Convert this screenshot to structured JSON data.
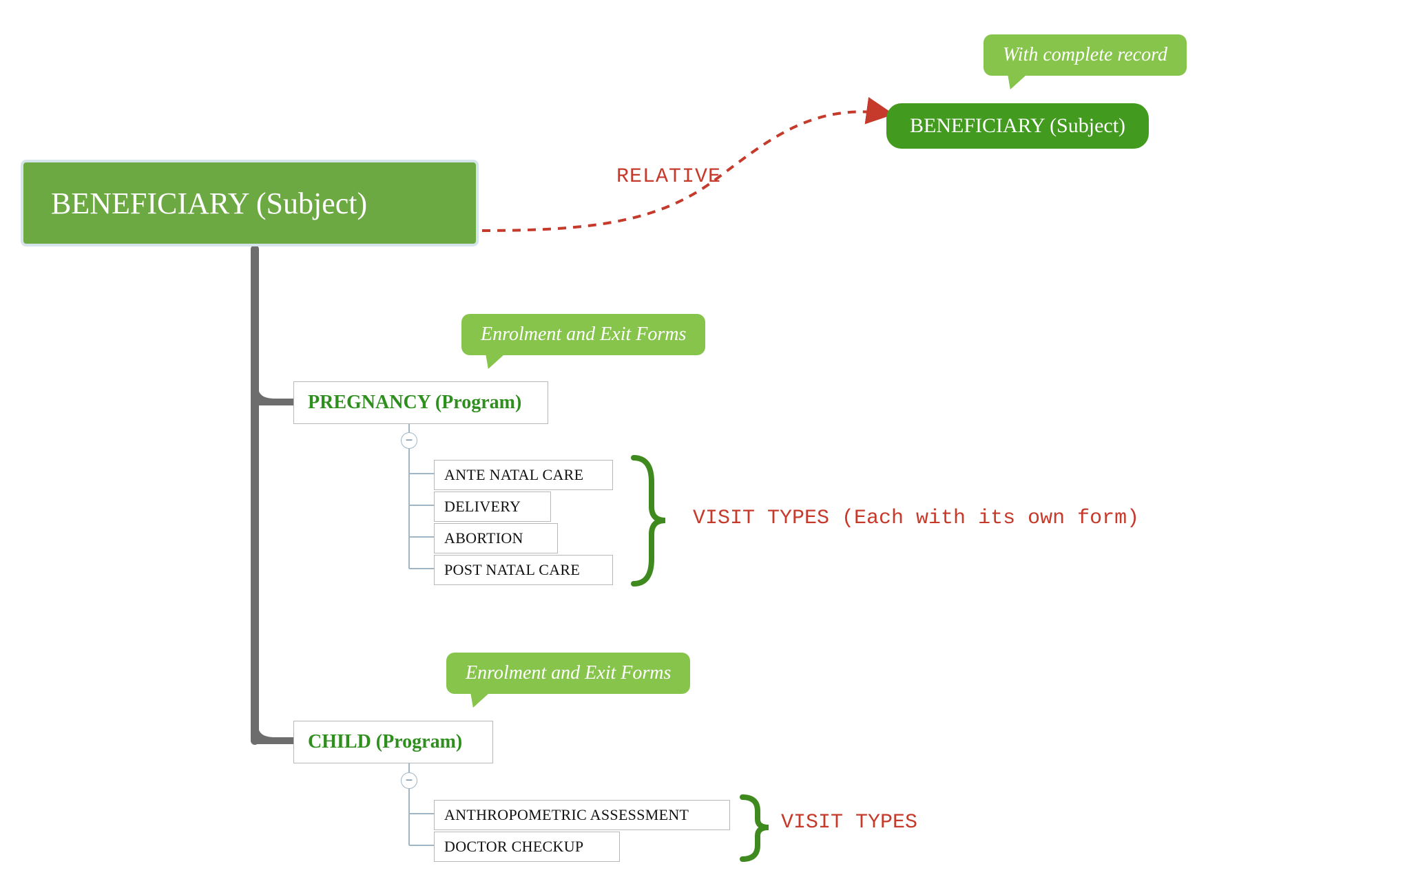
{
  "root": {
    "label": "BENEFICIARY (Subject)"
  },
  "relative_target": {
    "label": "BENEFICIARY (Subject)",
    "callout": "With complete record"
  },
  "relation_label": "RELATIVE",
  "programs": [
    {
      "name": "PREGNANCY (Program)",
      "callout": "Enrolment and Exit Forms",
      "visits": [
        "ANTE NATAL CARE",
        "DELIVERY",
        "ABORTION",
        "POST NATAL CARE"
      ],
      "visit_annotation": "VISIT TYPES (Each with its own form)"
    },
    {
      "name": "CHILD (Program)",
      "callout": "Enrolment and Exit Forms",
      "visits": [
        "ANTHROPOMETRIC ASSESSMENT",
        "DOCTOR CHECKUP"
      ],
      "visit_annotation": "VISIT TYPES"
    }
  ],
  "colors": {
    "green_main": "#6da943",
    "green_dark": "#429a1f",
    "green_light": "#87c44b",
    "red": "#c63a2b",
    "tree_line": "#6d6d6d"
  },
  "toggle_glyph": "−"
}
